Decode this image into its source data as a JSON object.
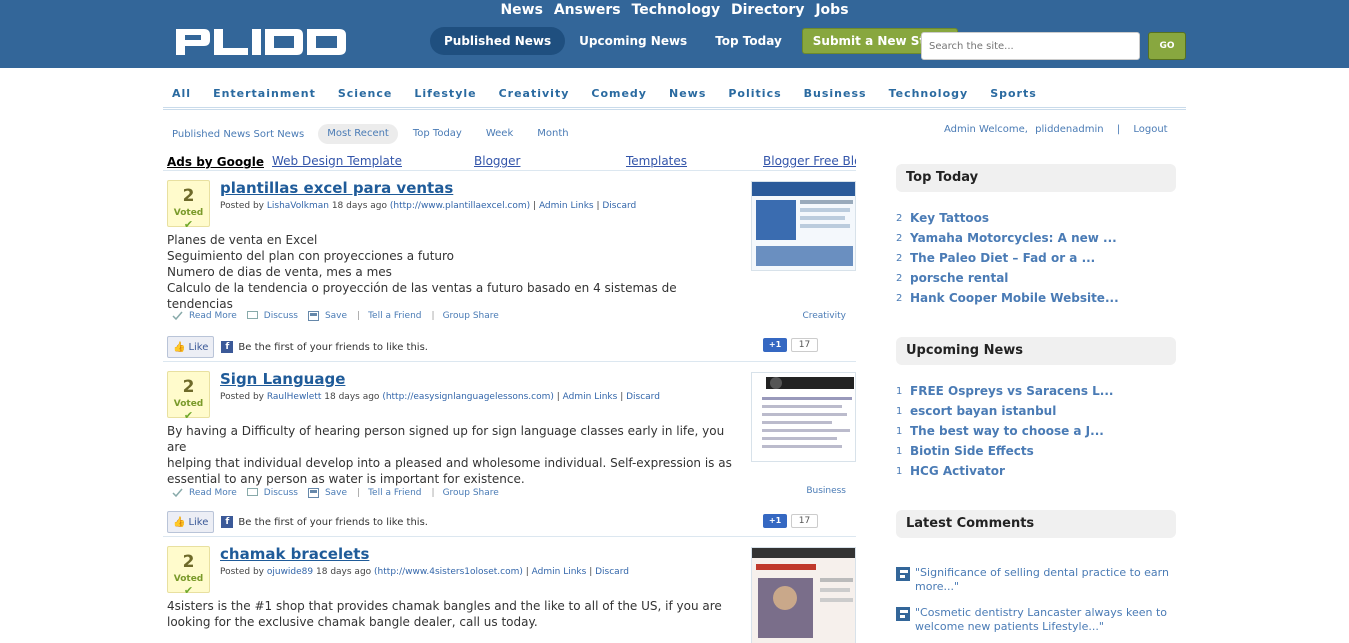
{
  "header": {
    "top_links": [
      "News",
      "Answers",
      "Technology",
      "Directory",
      "Jobs"
    ],
    "logo_text": "PLIDD",
    "tabs": [
      {
        "label": "Published News",
        "active": true
      },
      {
        "label": "Upcoming News",
        "active": false
      },
      {
        "label": "Top Today",
        "active": false
      }
    ],
    "submit_label": "Submit a New Story",
    "search_placeholder": "Search the site...",
    "search_button": "GO",
    "colors": {
      "header_bg": "#336699",
      "accent_green": "#88a73f"
    }
  },
  "categories": [
    "All",
    "Entertainment",
    "Science",
    "Lifestyle",
    "Creativity",
    "Comedy",
    "News",
    "Politics",
    "Business",
    "Technology",
    "Sports"
  ],
  "sortbar": {
    "label": "Published News Sort News",
    "options": [
      {
        "label": "Most Recent",
        "active": true
      },
      {
        "label": "Top Today",
        "active": false
      },
      {
        "label": "Week",
        "active": false
      },
      {
        "label": "Month",
        "active": false
      }
    ]
  },
  "admin": {
    "welcome": "Admin Welcome,",
    "username": "pliddenadmin",
    "separator": "|",
    "logout": "Logout"
  },
  "ads": {
    "label": "Ads by Google",
    "links": [
      "Web Design Template",
      "Blogger",
      "Templates",
      "Blogger Free Blo"
    ]
  },
  "stories": [
    {
      "votes": "2",
      "voted_label": "Voted",
      "title": "plantillas excel para ventas",
      "posted_by_label": "Posted by",
      "author": "LishaVolkman",
      "age": "18 days ago",
      "url": "(http://www.plantillaexcel.com)",
      "admin_links": "Admin Links",
      "discard": "Discard",
      "body_lines": [
        "Planes de venta en Excel",
        "Seguimiento del plan con proyecciones a futuro",
        "Numero de dias de venta, mes a mes",
        "Calculo de la tendencia o proyección de las ventas a futuro basado en 4 sistemas de tendencias"
      ],
      "category": "Creativity",
      "plus_count": "17"
    },
    {
      "votes": "2",
      "voted_label": "Voted",
      "title": "Sign Language",
      "posted_by_label": "Posted by",
      "author": "RaulHewlett",
      "age": "18 days ago",
      "url": "(http://easysignlanguagelessons.com)",
      "admin_links": "Admin Links",
      "discard": "Discard",
      "body_lines": [
        "By having a Difficulty of hearing person signed up for sign language classes early in life, you are",
        "helping that individual develop into a pleased and wholesome individual. Self-expression is as",
        "essential to any person as water is important for existence."
      ],
      "category": "Business",
      "plus_count": "17"
    },
    {
      "votes": "2",
      "voted_label": "Voted",
      "title": "chamak bracelets",
      "posted_by_label": "Posted by",
      "author": "ojuwide89",
      "age": "18 days ago",
      "url": "(http://www.4sisters1oloset.com)",
      "admin_links": "Admin Links",
      "discard": "Discard",
      "body_lines": [
        "4sisters is the #1 shop that provides chamak bangles and the like to all of the US, if you are",
        "looking for the exclusive chamak bangle dealer, call us today."
      ],
      "category": "",
      "plus_count": ""
    }
  ],
  "story_actions": {
    "read_more": "Read More",
    "discuss": "Discuss",
    "save": "Save",
    "tell_friend": "Tell a Friend",
    "group_share": "Group Share",
    "like": "Like",
    "fb_text": "Be the first of your friends to like this.",
    "plus_one": "+1"
  },
  "sidebar": {
    "top_today": {
      "title": "Top Today",
      "items": [
        {
          "num": "2",
          "title": "Key Tattoos"
        },
        {
          "num": "2",
          "title": "Yamaha Motorcycles: A new ..."
        },
        {
          "num": "2",
          "title": "The Paleo Diet – Fad or a ..."
        },
        {
          "num": "2",
          "title": "porsche rental"
        },
        {
          "num": "2",
          "title": "Hank Cooper Mobile Website..."
        }
      ]
    },
    "upcoming": {
      "title": "Upcoming News",
      "items": [
        {
          "num": "1",
          "title": "FREE Ospreys vs Saracens L..."
        },
        {
          "num": "1",
          "title": "escort bayan istanbul"
        },
        {
          "num": "1",
          "title": "The best way to choose a J..."
        },
        {
          "num": "1",
          "title": "Biotin Side Effects"
        },
        {
          "num": "1",
          "title": "HCG Activator"
        }
      ]
    },
    "comments": {
      "title": "Latest Comments",
      "items": [
        {
          "line1": "\"Significance of selling dental practice to earn",
          "line2": "more...\""
        },
        {
          "line1": "\"Cosmetic dentistry Lancaster always keen to",
          "line2": "welcome new patients Lifestyle...\""
        }
      ]
    }
  }
}
